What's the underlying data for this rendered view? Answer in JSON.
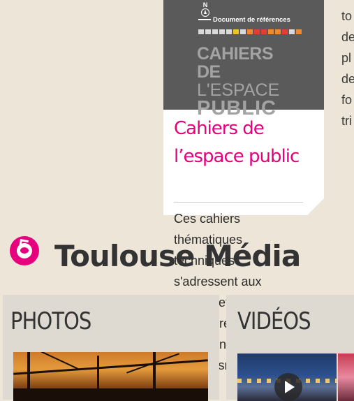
{
  "side_text": {
    "lines": [
      "to",
      "de",
      "pl",
      "de",
      "fo",
      "tri"
    ]
  },
  "card": {
    "cover": {
      "north_label": "N",
      "doc_reference": "Document de références",
      "title_line1": "CAHIERS DE",
      "title_line2": "L'ESPACE",
      "title_line3": "PUBLIC"
    },
    "heading": "Cahiers de l’espace public",
    "description": "Ces cahiers thématiques techniques s'adressent aux acteurs et partenaires des opérations d'urbanisme"
  },
  "toulouse_media": {
    "title": "Toulouse Média"
  },
  "panels": {
    "photos_label": "PHOTOS",
    "videos_label": "VIDÉOS"
  },
  "colors": {
    "accent": "#e6007e",
    "background": "#ede6d8",
    "cover": "#5a5a5a"
  },
  "icons": {
    "logo": "toulouse-media-logo-icon",
    "play": "play-icon",
    "compass": "north-arrow-icon"
  }
}
